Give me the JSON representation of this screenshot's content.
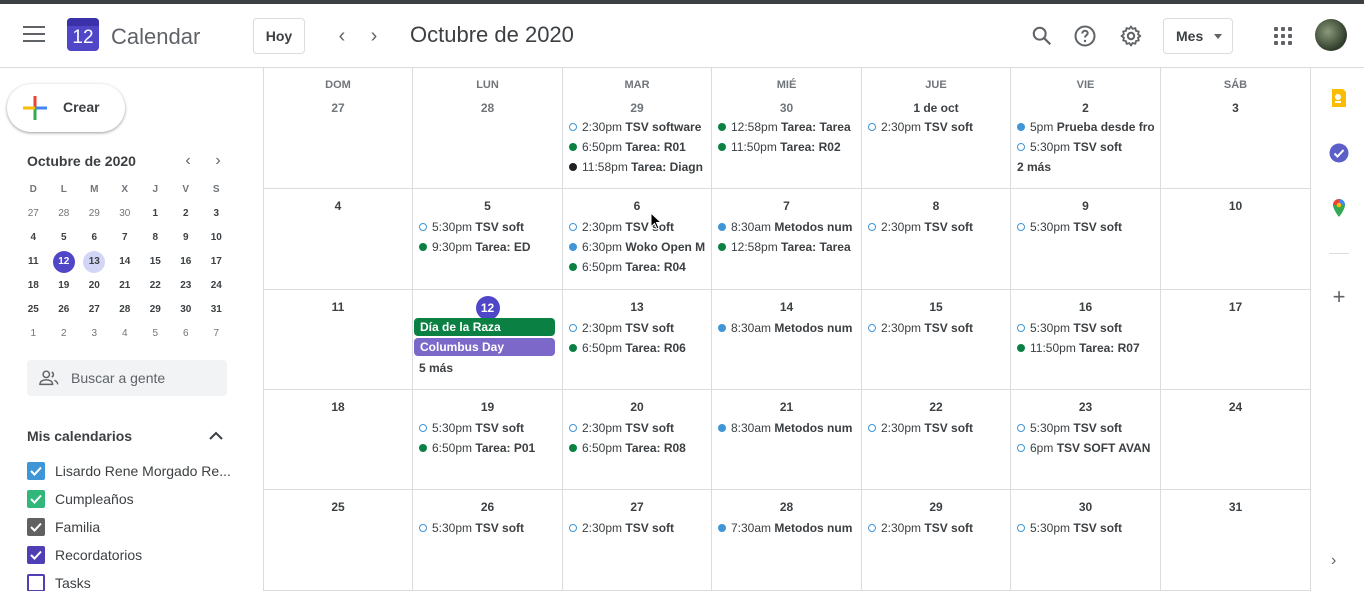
{
  "app": {
    "title": "Calendar",
    "logo_day": "12"
  },
  "toolbar": {
    "today_label": "Hoy",
    "month_title": "Octubre de 2020",
    "view_label": "Mes"
  },
  "sidebar": {
    "create_label": "Crear",
    "mini_title": "Octubre de 2020",
    "mini_heads": [
      "D",
      "L",
      "M",
      "X",
      "J",
      "V",
      "S"
    ],
    "mini_weeks": [
      [
        "27",
        "28",
        "29",
        "30",
        "1",
        "2",
        "3"
      ],
      [
        "4",
        "5",
        "6",
        "7",
        "8",
        "9",
        "10"
      ],
      [
        "11",
        "12",
        "13",
        "14",
        "15",
        "16",
        "17"
      ],
      [
        "18",
        "19",
        "20",
        "21",
        "22",
        "23",
        "24"
      ],
      [
        "25",
        "26",
        "27",
        "28",
        "29",
        "30",
        "31"
      ],
      [
        "1",
        "2",
        "3",
        "4",
        "5",
        "6",
        "7"
      ]
    ],
    "people_search_placeholder": "Buscar a gente",
    "my_calendars_title": "Mis calendarios",
    "calendars": [
      {
        "label": "Lisardo Rene Morgado Re...",
        "color": "#3f96d6",
        "checked": true
      },
      {
        "label": "Cumpleaños",
        "color": "#33b679",
        "checked": true
      },
      {
        "label": "Familia",
        "color": "#616161",
        "checked": true
      },
      {
        "label": "Recordatorios",
        "color": "#4f3fb5",
        "checked": true
      },
      {
        "label": "Tasks",
        "color": "#4f3fb5",
        "checked": false
      }
    ]
  },
  "colors": {
    "accent": "#4f46c8",
    "blue": "#3f96d6",
    "green": "#0b8043",
    "black": "#202124",
    "lavender": "#7b68c8"
  },
  "month": {
    "weekday_heads": [
      "DOM",
      "LUN",
      "MAR",
      "MIÉ",
      "JUE",
      "VIE",
      "SÁB"
    ],
    "weeks": [
      [
        {
          "day": "27",
          "other": true,
          "events": []
        },
        {
          "day": "28",
          "other": true,
          "events": []
        },
        {
          "day": "29",
          "other": true,
          "events": [
            {
              "time": "2:30pm",
              "title": "TSV software",
              "style": "hollow"
            },
            {
              "time": "6:50pm",
              "title": "Tarea: R01",
              "style": "green"
            },
            {
              "time": "11:58pm",
              "title": "Tarea: Diagn",
              "style": "black"
            }
          ]
        },
        {
          "day": "30",
          "other": true,
          "events": [
            {
              "time": "12:58pm",
              "title": "Tarea: Tarea",
              "style": "green"
            },
            {
              "time": "11:50pm",
              "title": "Tarea: R02",
              "style": "green"
            }
          ]
        },
        {
          "day": "1 de oct",
          "other": false,
          "events": [
            {
              "time": "2:30pm",
              "title": "TSV soft",
              "style": "hollow"
            }
          ]
        },
        {
          "day": "2",
          "other": false,
          "events": [
            {
              "time": "5pm",
              "title": "Prueba desde fro",
              "style": "blue"
            },
            {
              "time": "5:30pm",
              "title": "TSV soft",
              "style": "hollow"
            }
          ],
          "more": "2 más"
        },
        {
          "day": "3",
          "other": false,
          "events": []
        }
      ],
      [
        {
          "day": "4",
          "events": []
        },
        {
          "day": "5",
          "events": [
            {
              "time": "5:30pm",
              "title": "TSV soft",
              "style": "hollow"
            },
            {
              "time": "9:30pm",
              "title": "Tarea: ED",
              "style": "green"
            }
          ]
        },
        {
          "day": "6",
          "events": [
            {
              "time": "2:30pm",
              "title": "TSV soft",
              "style": "hollow"
            },
            {
              "time": "6:30pm",
              "title": "Woko Open M",
              "style": "blue"
            },
            {
              "time": "6:50pm",
              "title": "Tarea: R04",
              "style": "green"
            }
          ]
        },
        {
          "day": "7",
          "events": [
            {
              "time": "8:30am",
              "title": "Metodos num",
              "style": "blue"
            },
            {
              "time": "12:58pm",
              "title": "Tarea: Tarea",
              "style": "green"
            }
          ]
        },
        {
          "day": "8",
          "events": [
            {
              "time": "2:30pm",
              "title": "TSV soft",
              "style": "hollow"
            }
          ]
        },
        {
          "day": "9",
          "events": [
            {
              "time": "5:30pm",
              "title": "TSV soft",
              "style": "hollow"
            }
          ]
        },
        {
          "day": "10",
          "events": []
        }
      ],
      [
        {
          "day": "11",
          "events": []
        },
        {
          "day": "12",
          "today": true,
          "allday": [
            {
              "title": "Día de la Raza",
              "color": "#0b8043"
            },
            {
              "title": "Columbus Day",
              "color": "#7b68c8"
            }
          ],
          "events": [],
          "more": "5 más"
        },
        {
          "day": "13",
          "events": [
            {
              "time": "2:30pm",
              "title": "TSV soft",
              "style": "hollow"
            },
            {
              "time": "6:50pm",
              "title": "Tarea: R06",
              "style": "green"
            }
          ]
        },
        {
          "day": "14",
          "events": [
            {
              "time": "8:30am",
              "title": "Metodos num",
              "style": "blue"
            }
          ]
        },
        {
          "day": "15",
          "events": [
            {
              "time": "2:30pm",
              "title": "TSV soft",
              "style": "hollow"
            }
          ]
        },
        {
          "day": "16",
          "events": [
            {
              "time": "5:30pm",
              "title": "TSV soft",
              "style": "hollow"
            },
            {
              "time": "11:50pm",
              "title": "Tarea: R07",
              "style": "green"
            }
          ]
        },
        {
          "day": "17",
          "events": []
        }
      ],
      [
        {
          "day": "18",
          "events": []
        },
        {
          "day": "19",
          "events": [
            {
              "time": "5:30pm",
              "title": "TSV soft",
              "style": "hollow"
            },
            {
              "time": "6:50pm",
              "title": "Tarea: P01",
              "style": "green"
            }
          ]
        },
        {
          "day": "20",
          "events": [
            {
              "time": "2:30pm",
              "title": "TSV soft",
              "style": "hollow"
            },
            {
              "time": "6:50pm",
              "title": "Tarea: R08",
              "style": "green"
            }
          ]
        },
        {
          "day": "21",
          "events": [
            {
              "time": "8:30am",
              "title": "Metodos num",
              "style": "blue"
            }
          ]
        },
        {
          "day": "22",
          "events": [
            {
              "time": "2:30pm",
              "title": "TSV soft",
              "style": "hollow"
            }
          ]
        },
        {
          "day": "23",
          "events": [
            {
              "time": "5:30pm",
              "title": "TSV soft",
              "style": "hollow"
            },
            {
              "time": "6pm",
              "title": "TSV SOFT AVAN",
              "style": "hollow"
            }
          ]
        },
        {
          "day": "24",
          "events": []
        }
      ],
      [
        {
          "day": "25",
          "events": []
        },
        {
          "day": "26",
          "events": [
            {
              "time": "5:30pm",
              "title": "TSV soft",
              "style": "hollow"
            }
          ]
        },
        {
          "day": "27",
          "events": [
            {
              "time": "2:30pm",
              "title": "TSV soft",
              "style": "hollow"
            }
          ]
        },
        {
          "day": "28",
          "events": [
            {
              "time": "7:30am",
              "title": "Metodos num",
              "style": "blue"
            }
          ]
        },
        {
          "day": "29",
          "events": [
            {
              "time": "2:30pm",
              "title": "TSV soft",
              "style": "hollow"
            }
          ]
        },
        {
          "day": "30",
          "events": [
            {
              "time": "5:30pm",
              "title": "TSV soft",
              "style": "hollow"
            }
          ]
        },
        {
          "day": "31",
          "events": []
        }
      ]
    ]
  },
  "side_panel": {
    "icons": [
      "keep-icon",
      "tasks-icon",
      "maps-icon"
    ]
  }
}
